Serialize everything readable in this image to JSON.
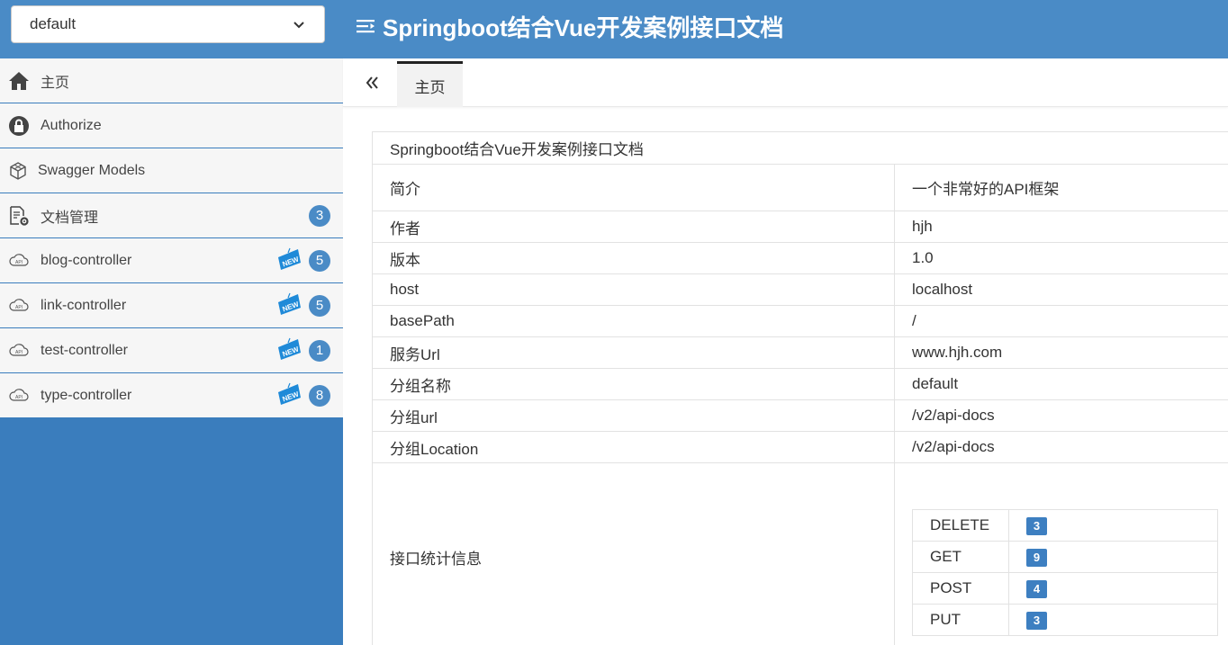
{
  "header": {
    "group_select": "default",
    "title": "Springboot结合Vue开发案例接口文档"
  },
  "sidebar": {
    "items": [
      {
        "label": "主页",
        "icon": "home-icon"
      },
      {
        "label": "Authorize",
        "icon": "lock-icon"
      },
      {
        "label": "Swagger Models",
        "icon": "cube-icon"
      },
      {
        "label": "文档管理",
        "icon": "doc-gear-icon",
        "badge": "3"
      },
      {
        "label": "blog-controller",
        "icon": "api-cloud-icon",
        "badge": "5",
        "new": true
      },
      {
        "label": "link-controller",
        "icon": "api-cloud-icon",
        "badge": "5",
        "new": true
      },
      {
        "label": "test-controller",
        "icon": "api-cloud-icon",
        "badge": "1",
        "new": true
      },
      {
        "label": "type-controller",
        "icon": "api-cloud-icon",
        "badge": "8",
        "new": true
      }
    ],
    "new_tag": "NEW",
    "api_icon_text": "API"
  },
  "tabs": [
    {
      "label": "主页"
    }
  ],
  "info": {
    "title": "Springboot结合Vue开发案例接口文档",
    "rows": [
      {
        "key": "简介",
        "value": "一个非常好的API框架"
      },
      {
        "key": "作者",
        "value": "hjh"
      },
      {
        "key": "版本",
        "value": "1.0"
      },
      {
        "key": "host",
        "value": "localhost"
      },
      {
        "key": "basePath",
        "value": "/"
      },
      {
        "key": "服务Url",
        "value": "www.hjh.com"
      },
      {
        "key": "分组名称",
        "value": "default"
      },
      {
        "key": "分组url",
        "value": "/v2/api-docs"
      },
      {
        "key": "分组Location",
        "value": "/v2/api-docs"
      }
    ],
    "stats_label": "接口统计信息",
    "stats": [
      {
        "method": "DELETE",
        "count": "3"
      },
      {
        "method": "GET",
        "count": "9"
      },
      {
        "method": "POST",
        "count": "4"
      },
      {
        "method": "PUT",
        "count": "3"
      }
    ]
  },
  "colors": {
    "header_bg": "#4a8bc6",
    "sidebar_bg": "#3a7dbd",
    "badge": "#4a8bc6",
    "new_tag": "#1f8ad8"
  }
}
